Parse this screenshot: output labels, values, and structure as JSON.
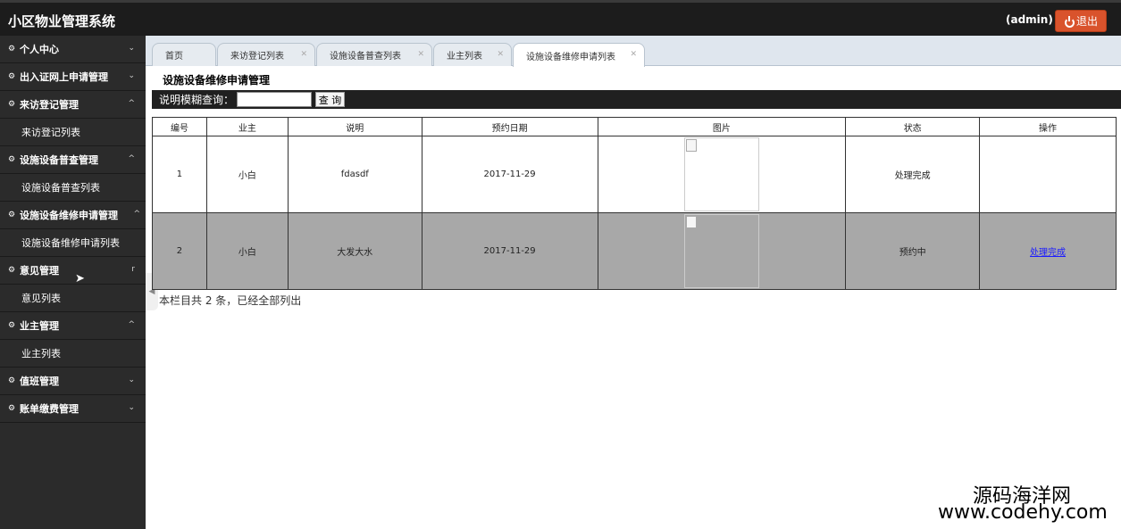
{
  "header": {
    "app_title": "小区物业管理系统",
    "user": "(admin)",
    "logout_label": "退出"
  },
  "sidebar": {
    "items": [
      {
        "label": "个人中心",
        "chevron": "⌄",
        "children": []
      },
      {
        "label": "出入证网上申请管理",
        "chevron": "⌄",
        "children": []
      },
      {
        "label": "来访登记管理",
        "chevron": "^",
        "children": [
          "来访登记列表"
        ]
      },
      {
        "label": "设施设备普查管理",
        "chevron": "^",
        "children": [
          "设施设备普查列表"
        ]
      },
      {
        "label": "设施设备维修申请管理",
        "chevron": "^",
        "children": [
          "设施设备维修申请列表"
        ]
      },
      {
        "label": "意见管理",
        "chevron": "r",
        "children": [
          "意见列表"
        ]
      },
      {
        "label": "业主管理",
        "chevron": "^",
        "children": [
          "业主列表"
        ]
      },
      {
        "label": "值班管理",
        "chevron": "⌄",
        "children": []
      },
      {
        "label": "账单缴费管理",
        "chevron": "⌄",
        "children": []
      }
    ]
  },
  "tabs": [
    {
      "label": "首页"
    },
    {
      "label": "来访登记列表"
    },
    {
      "label": "设施设备普查列表"
    },
    {
      "label": "业主列表"
    },
    {
      "label": "设施设备维修申请列表",
      "active": true
    }
  ],
  "main": {
    "title": "设施设备维修申请管理",
    "search_label": "说明模糊查询：",
    "search_value": "",
    "search_button": "查 询",
    "columns": [
      "编号",
      "业主",
      "说明",
      "预约日期",
      "图片",
      "状态",
      "操作"
    ],
    "rows": [
      {
        "id": "1",
        "owner": "小白",
        "desc": "fdasdf",
        "date": "2017-11-29",
        "status": "处理完成",
        "action": ""
      },
      {
        "id": "2",
        "owner": "小白",
        "desc": "大发大水",
        "date": "2017-11-29",
        "status": "预约中",
        "action": "处理完成"
      }
    ],
    "footer_note": "本栏目共 2 条，已经全部列出"
  },
  "watermark": {
    "line1": "源码海洋网",
    "line2": "www.codehy.com"
  }
}
